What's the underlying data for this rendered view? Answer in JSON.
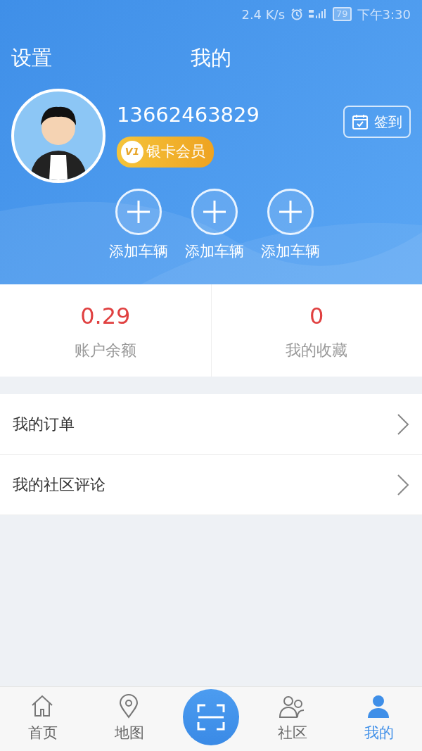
{
  "status_bar": {
    "speed": "2.4 K/s",
    "battery": "79",
    "time": "下午3:30"
  },
  "header": {
    "left": "设置",
    "title": "我的"
  },
  "profile": {
    "phone": "13662463829",
    "member_level": "V1",
    "member_label": "银卡会员",
    "checkin": "签到"
  },
  "vehicles": [
    {
      "label": "添加车辆"
    },
    {
      "label": "添加车辆"
    },
    {
      "label": "添加车辆"
    }
  ],
  "stats": [
    {
      "value": "0.29",
      "label": "账户余额"
    },
    {
      "value": "0",
      "label": "我的收藏"
    }
  ],
  "menu": [
    {
      "label": "我的订单"
    },
    {
      "label": "我的社区评论"
    }
  ],
  "tabs": [
    {
      "kind": "home",
      "label": "首页",
      "selected": false
    },
    {
      "kind": "map",
      "label": "地图",
      "selected": false
    },
    {
      "kind": "scan"
    },
    {
      "kind": "community",
      "label": "社区",
      "selected": false
    },
    {
      "kind": "me",
      "label": "我的",
      "selected": true
    }
  ]
}
